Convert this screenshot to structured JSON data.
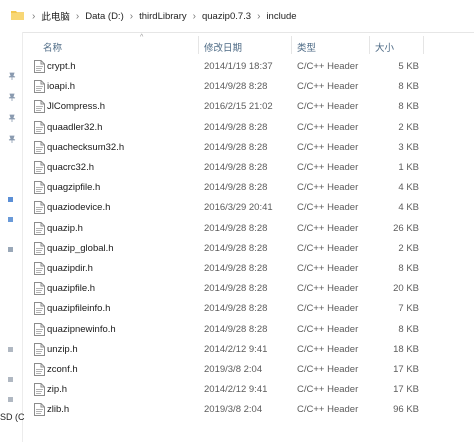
{
  "breadcrumb": [
    "此电脑",
    "Data (D:)",
    "thirdLibrary",
    "quazip0.7.3",
    "include"
  ],
  "columns": {
    "name": "名称",
    "date": "修改日期",
    "type": "类型",
    "size": "大小"
  },
  "nav": {
    "drive_fragment": "SD (C"
  },
  "colors": {
    "folder": "#f3c74f",
    "header_text": "#4d6a85",
    "pin": "#8a9bb0"
  },
  "files": [
    {
      "name": "crypt.h",
      "date": "2014/1/19 18:37",
      "type": "C/C++ Header",
      "size": "5 KB"
    },
    {
      "name": "ioapi.h",
      "date": "2014/9/28 8:28",
      "type": "C/C++ Header",
      "size": "8 KB"
    },
    {
      "name": "JlCompress.h",
      "date": "2016/2/15 21:02",
      "type": "C/C++ Header",
      "size": "8 KB"
    },
    {
      "name": "quaadler32.h",
      "date": "2014/9/28 8:28",
      "type": "C/C++ Header",
      "size": "2 KB"
    },
    {
      "name": "quachecksum32.h",
      "date": "2014/9/28 8:28",
      "type": "C/C++ Header",
      "size": "3 KB"
    },
    {
      "name": "quacrc32.h",
      "date": "2014/9/28 8:28",
      "type": "C/C++ Header",
      "size": "1 KB"
    },
    {
      "name": "quagzipfile.h",
      "date": "2014/9/28 8:28",
      "type": "C/C++ Header",
      "size": "4 KB"
    },
    {
      "name": "quaziodevice.h",
      "date": "2016/3/29 20:41",
      "type": "C/C++ Header",
      "size": "4 KB"
    },
    {
      "name": "quazip.h",
      "date": "2014/9/28 8:28",
      "type": "C/C++ Header",
      "size": "26 KB"
    },
    {
      "name": "quazip_global.h",
      "date": "2014/9/28 8:28",
      "type": "C/C++ Header",
      "size": "2 KB"
    },
    {
      "name": "quazipdir.h",
      "date": "2014/9/28 8:28",
      "type": "C/C++ Header",
      "size": "8 KB"
    },
    {
      "name": "quazipfile.h",
      "date": "2014/9/28 8:28",
      "type": "C/C++ Header",
      "size": "20 KB"
    },
    {
      "name": "quazipfileinfo.h",
      "date": "2014/9/28 8:28",
      "type": "C/C++ Header",
      "size": "7 KB"
    },
    {
      "name": "quazipnewinfo.h",
      "date": "2014/9/28 8:28",
      "type": "C/C++ Header",
      "size": "8 KB"
    },
    {
      "name": "unzip.h",
      "date": "2014/2/12 9:41",
      "type": "C/C++ Header",
      "size": "18 KB"
    },
    {
      "name": "zconf.h",
      "date": "2019/3/8 2:04",
      "type": "C/C++ Header",
      "size": "17 KB"
    },
    {
      "name": "zip.h",
      "date": "2014/2/12 9:41",
      "type": "C/C++ Header",
      "size": "17 KB"
    },
    {
      "name": "zlib.h",
      "date": "2019/3/8 2:04",
      "type": "C/C++ Header",
      "size": "96 KB"
    }
  ]
}
